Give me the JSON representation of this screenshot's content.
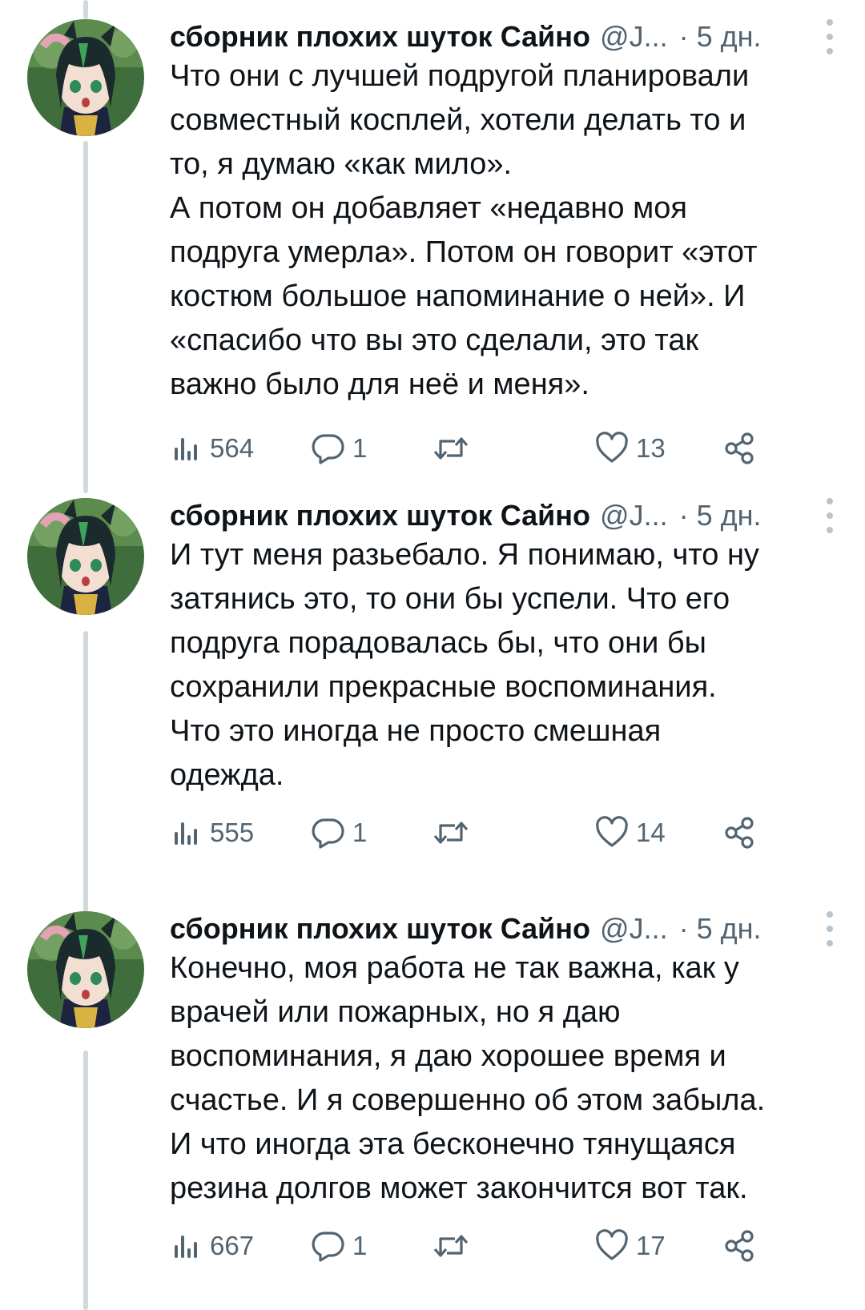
{
  "author": {
    "name": "сборник плохих шуток Сайно",
    "handle": "@J...",
    "separator": "·",
    "time": "5 дн."
  },
  "icons": {
    "views": "bar-chart-icon",
    "reply": "reply-bubble-icon",
    "retweet": "retweet-icon",
    "like": "heart-icon",
    "share": "share-icon",
    "more": "more-vertical-icon"
  },
  "colors": {
    "text": "#0f1419",
    "muted": "#536471",
    "thread_line": "#cfd9de"
  },
  "tweets": [
    {
      "lines": [
        "Что они с лучшей подругой планировали",
        "совместный косплей, хотели делать то и",
        "то, я думаю «как мило».",
        "А потом он добавляет «недавно моя",
        "подруга умерла». Потом он говорит «этот",
        "костюм большое напоминание о ней». И",
        "«спасибо что вы это сделали, это так",
        "важно было для неё и меня»."
      ],
      "views": "564",
      "replies": "1",
      "likes": "13"
    },
    {
      "lines": [
        "И тут меня разьебало. Я понимаю, что ну",
        "затянись это, то они бы успели. Что его",
        "подруга порадовалась бы, что они бы",
        "сохранили прекрасные воспоминания.",
        "Что это иногда не просто смешная",
        "одежда."
      ],
      "views": "555",
      "replies": "1",
      "likes": "14"
    },
    {
      "lines": [
        "Конечно, моя работа не так важна, как у",
        "врачей или пожарных, но я даю",
        "воспоминания, я даю хорошее время и",
        "счастье. И я совершенно об этом забыла.",
        "И что иногда эта бесконечно тянущаяся",
        "резина долгов может закончится вот так."
      ],
      "views": "667",
      "replies": "1",
      "likes": "17"
    }
  ]
}
